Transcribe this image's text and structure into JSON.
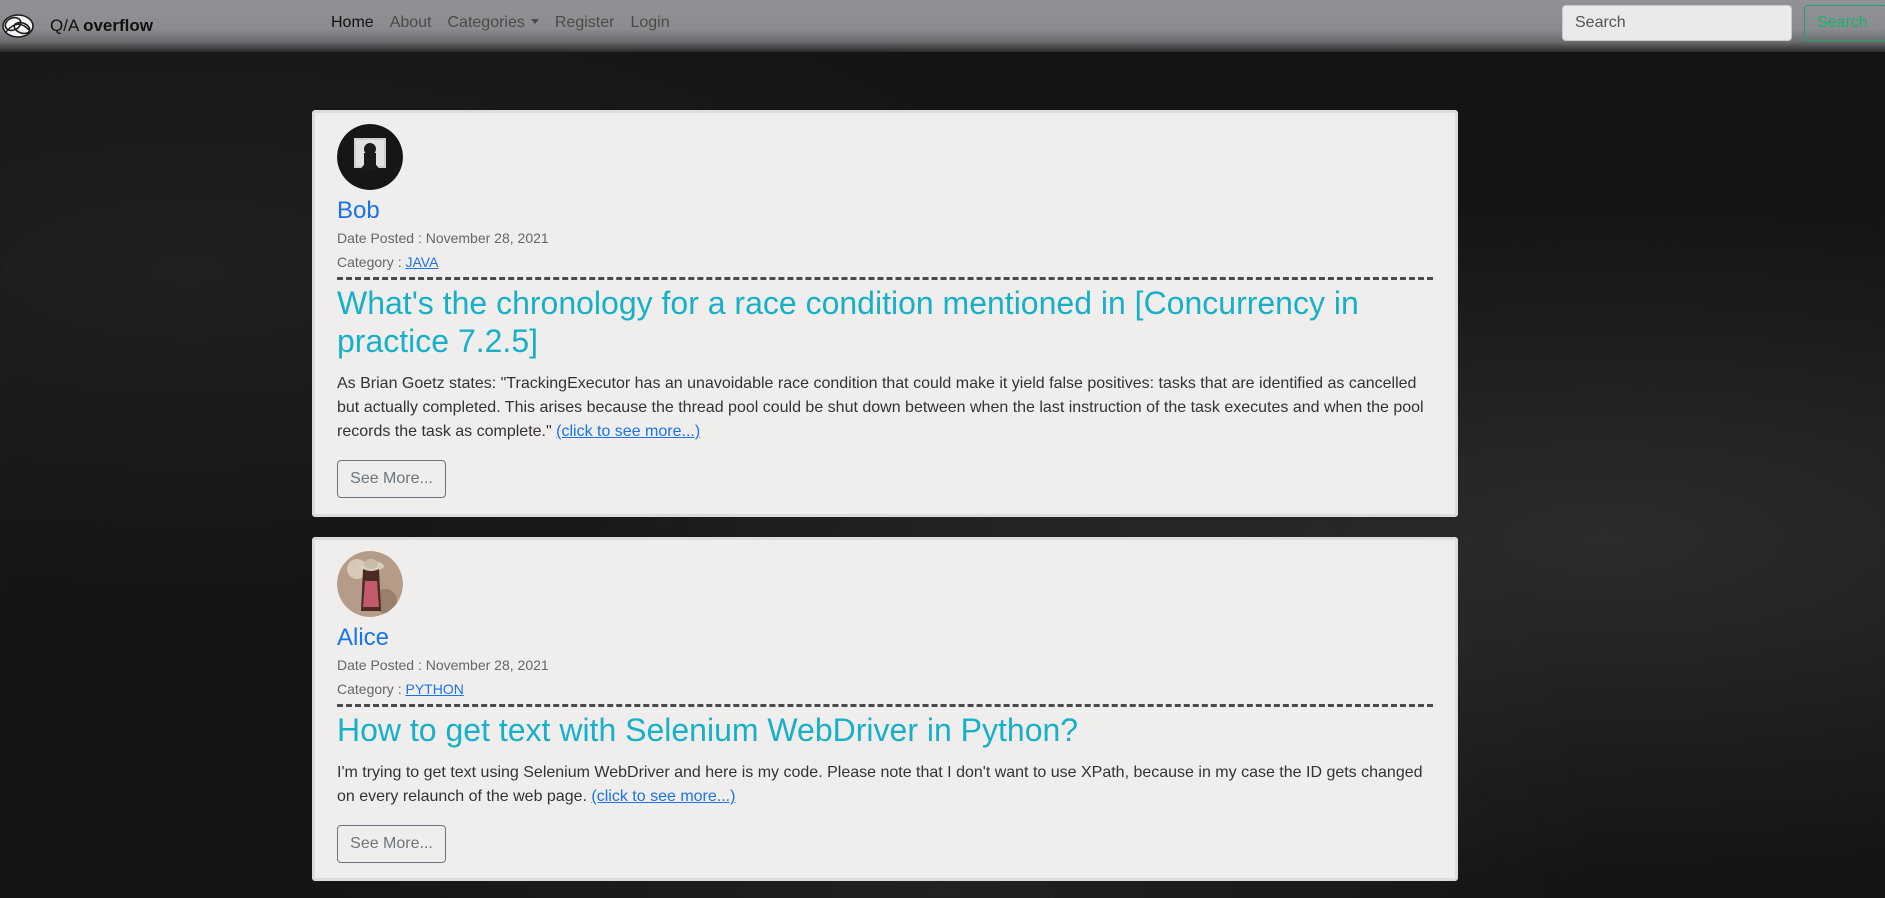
{
  "navbar": {
    "brand_prefix": "Q/A",
    "brand_bold": "overflow",
    "links": [
      {
        "label": "Home"
      },
      {
        "label": "About"
      },
      {
        "label": "Categories"
      },
      {
        "label": "Register"
      },
      {
        "label": "Login"
      }
    ],
    "search_placeholder": "Search",
    "search_button": "Search"
  },
  "posts": [
    {
      "author": "Bob",
      "date_label": "Date Posted : November 28, 2021",
      "category_prefix": "Category :",
      "category": "JAVA",
      "title": "What's the chronology for a race condition mentioned in [Concurrency in practice 7.2.5]",
      "excerpt": "As Brian Goetz states: \"TrackingExecutor has an unavoidable race condition that could make it yield false positives: tasks that are identified as cancelled but actually completed. This arises because the thread pool could be shut down between when the last instruction of the task executes and when the pool records the task as complete.\"",
      "more_link": "(click to see more...)",
      "button": "See More..."
    },
    {
      "author": "Alice",
      "date_label": "Date Posted : November 28, 2021",
      "category_prefix": "Category :",
      "category": "PYTHON",
      "title": "How to get text with Selenium WebDriver in Python?",
      "excerpt": "I'm trying to get text using Selenium WebDriver and here is my code. Please note that I don't want to use XPath, because in my case the ID gets changed on every relaunch of the web page.",
      "more_link": "(click to see more...)",
      "button": "See More..."
    }
  ]
}
